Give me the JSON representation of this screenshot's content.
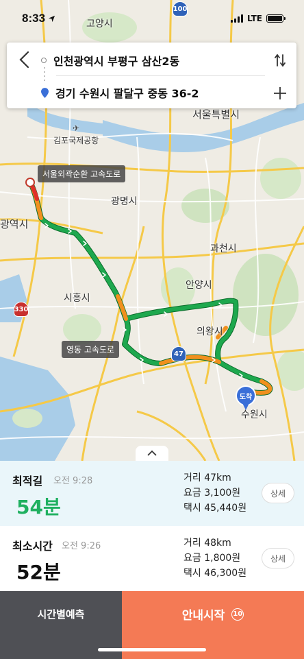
{
  "status": {
    "time": "8:33",
    "network": "LTE"
  },
  "route": {
    "origin": "인천광역시 부평구 삼산2동",
    "destination": "경기 수원시 팔달구 중동 36-2"
  },
  "map": {
    "labels": {
      "goyang": "고양시",
      "gimpo_airport": "김포국제공항",
      "seoul": "서울특별시",
      "gwangmyeong": "광명시",
      "incheon": "광역시",
      "gwacheon": "과천시",
      "siheung": "시흥시",
      "anyang": "안양시",
      "uiwang": "의왕시",
      "suwon": "수원시"
    },
    "callouts": {
      "start_road": "서울외곽순환 고속도로",
      "mid_road": "영동 고속도로"
    },
    "shields": {
      "s100": "100",
      "s330": "330",
      "s47": "47"
    },
    "dest_pin": "도착"
  },
  "options": [
    {
      "title": "최적길",
      "eta": "오전 9:28",
      "duration": "54분",
      "distance": "거리 47km",
      "fee": "요금 3,100원",
      "taxi": "택시 45,440원",
      "detail": "상세"
    },
    {
      "title": "최소시간",
      "eta": "오전 9:26",
      "duration": "52분",
      "distance": "거리 48km",
      "fee": "요금 1,800원",
      "taxi": "택시 46,300원",
      "detail": "상세"
    }
  ],
  "footer": {
    "predict": "시간별예측",
    "start": "안내시작",
    "countdown": "10"
  },
  "colors": {
    "route_green": "#1ea84e",
    "route_orange": "#f0901e",
    "route_red": "#e0302a",
    "accent_blue": "#3a6fd8",
    "start_button": "#f47a55",
    "predict_button": "#4f5055"
  }
}
